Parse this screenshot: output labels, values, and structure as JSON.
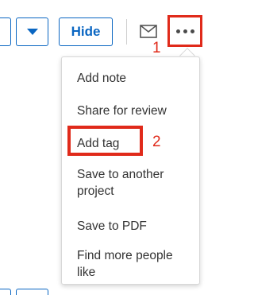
{
  "toolbar": {
    "hide_label": "Hide",
    "step1_label": "1",
    "icons": [
      "chevron-down-icon",
      "mail-icon",
      "more-icon"
    ]
  },
  "menu": {
    "items": [
      "Add note",
      "Share for review",
      "Add tag",
      "Save to another project",
      "Save to PDF",
      "Find more people like"
    ],
    "step2_label": "2"
  },
  "colors": {
    "accent": "#0a66c2",
    "annotation": "#e02a1a"
  }
}
